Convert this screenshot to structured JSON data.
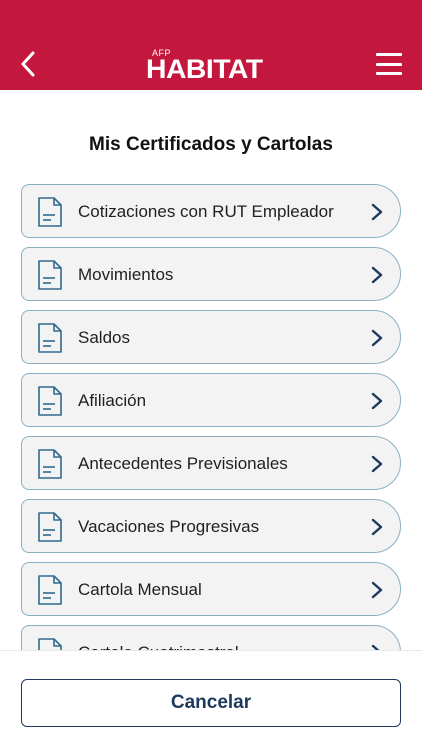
{
  "header": {
    "logo_small": "AFP",
    "logo_brand": "HABITAT",
    "background": "#c3173e"
  },
  "page": {
    "title": "Mis Certificados y Cartolas"
  },
  "items": [
    {
      "label": "Cotizaciones con RUT Empleador",
      "icon": "document-icon"
    },
    {
      "label": "Movimientos",
      "icon": "document-icon"
    },
    {
      "label": "Saldos",
      "icon": "document-icon"
    },
    {
      "label": "Afiliación",
      "icon": "document-icon"
    },
    {
      "label": "Antecedentes Previsionales",
      "icon": "document-icon"
    },
    {
      "label": "Vacaciones Progresivas",
      "icon": "document-icon"
    },
    {
      "label": "Cartola Mensual",
      "icon": "document-icon"
    },
    {
      "label": "Cartola Cuatrimestral",
      "icon": "document-icon"
    }
  ],
  "footer": {
    "cancel_label": "Cancelar"
  },
  "colors": {
    "accent": "#c3173e",
    "icon_blue": "#2f6b8e",
    "button_navy": "#1d3a5c",
    "item_border": "#8ab0c6",
    "item_bg": "#f3f3f4"
  }
}
